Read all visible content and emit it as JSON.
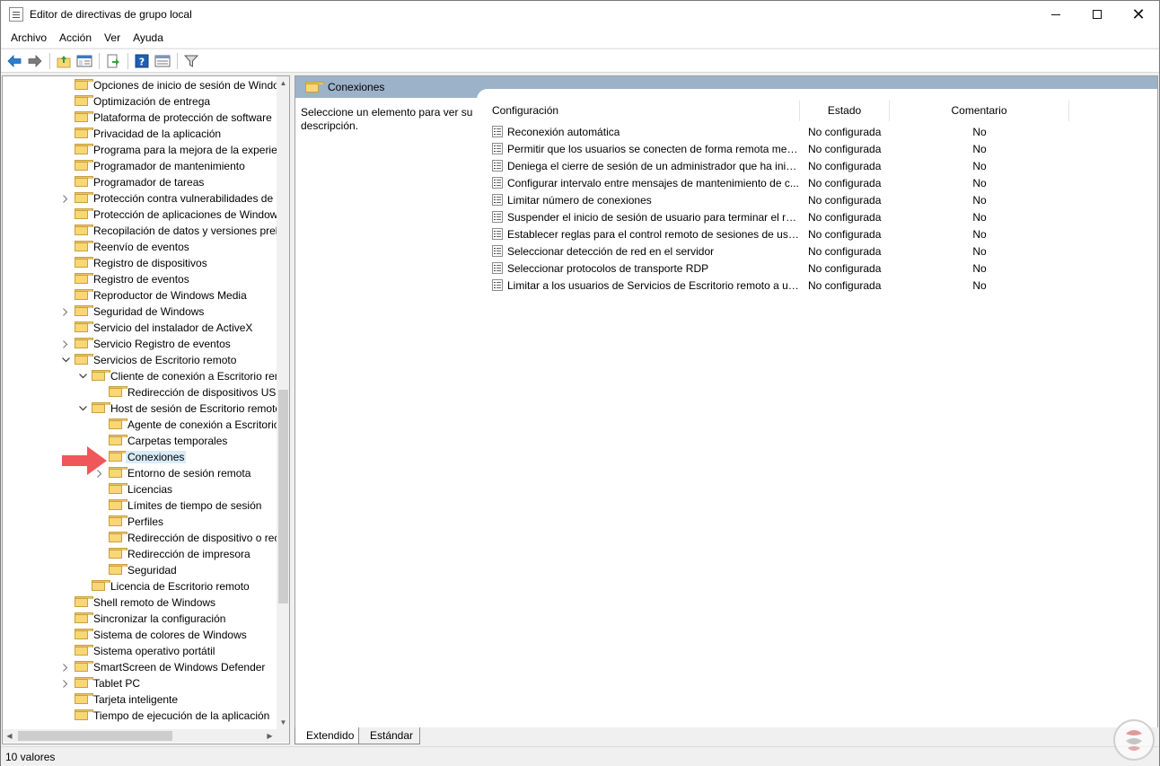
{
  "window": {
    "title": "Editor de directivas de grupo local",
    "controls": [
      "minimize",
      "maximize",
      "close"
    ]
  },
  "menu": [
    "Archivo",
    "Acción",
    "Ver",
    "Ayuda"
  ],
  "toolbar": {
    "buttons": [
      "back-icon",
      "forward-icon",
      "up-folder-icon",
      "show-hide-tree-icon",
      "export-list-icon",
      "help-icon",
      "properties-icon",
      "filter-icon"
    ]
  },
  "tree": {
    "items": [
      {
        "label": "Opciones de inicio de sesión de Windo",
        "level": 0,
        "expander": "none"
      },
      {
        "label": "Optimización de entrega",
        "level": 0,
        "expander": "none"
      },
      {
        "label": "Plataforma de protección de software",
        "level": 0,
        "expander": "none"
      },
      {
        "label": "Privacidad de la aplicación",
        "level": 0,
        "expander": "none"
      },
      {
        "label": "Programa para la mejora de la experien",
        "level": 0,
        "expander": "none"
      },
      {
        "label": "Programador de mantenimiento",
        "level": 0,
        "expander": "none"
      },
      {
        "label": "Programador de tareas",
        "level": 0,
        "expander": "none"
      },
      {
        "label": "Protección contra vulnerabilidades de",
        "level": 0,
        "expander": "collapsed"
      },
      {
        "label": "Protección de aplicaciones de Window",
        "level": 0,
        "expander": "none"
      },
      {
        "label": "Recopilación de datos y versiones preli",
        "level": 0,
        "expander": "none"
      },
      {
        "label": "Reenvío de eventos",
        "level": 0,
        "expander": "none"
      },
      {
        "label": "Registro de dispositivos",
        "level": 0,
        "expander": "none"
      },
      {
        "label": "Registro de eventos",
        "level": 0,
        "expander": "none"
      },
      {
        "label": "Reproductor de Windows Media",
        "level": 0,
        "expander": "none"
      },
      {
        "label": "Seguridad de Windows",
        "level": 0,
        "expander": "collapsed"
      },
      {
        "label": "Servicio del instalador de ActiveX",
        "level": 0,
        "expander": "none"
      },
      {
        "label": "Servicio Registro de eventos",
        "level": 0,
        "expander": "collapsed"
      },
      {
        "label": "Servicios de Escritorio remoto",
        "level": 0,
        "expander": "expanded"
      },
      {
        "label": "Cliente de conexión a Escritorio rem",
        "level": 1,
        "expander": "expanded"
      },
      {
        "label": "Redirección de dispositivos USB",
        "level": 2,
        "expander": "none"
      },
      {
        "label": "Host de sesión de Escritorio remoto",
        "level": 1,
        "expander": "expanded"
      },
      {
        "label": "Agente de conexión a Escritorio",
        "level": 2,
        "expander": "none"
      },
      {
        "label": "Carpetas temporales",
        "level": 2,
        "expander": "none"
      },
      {
        "label": "Conexiones",
        "level": 2,
        "expander": "none",
        "selected": true
      },
      {
        "label": "Entorno de sesión remota",
        "level": 2,
        "expander": "collapsed"
      },
      {
        "label": "Licencias",
        "level": 2,
        "expander": "none"
      },
      {
        "label": "Límites de tiempo de sesión",
        "level": 2,
        "expander": "none"
      },
      {
        "label": "Perfiles",
        "level": 2,
        "expander": "none"
      },
      {
        "label": "Redirección de dispositivo o rec",
        "level": 2,
        "expander": "none"
      },
      {
        "label": "Redirección de impresora",
        "level": 2,
        "expander": "none"
      },
      {
        "label": "Seguridad",
        "level": 2,
        "expander": "none"
      },
      {
        "label": "Licencia de Escritorio remoto",
        "level": 1,
        "expander": "none"
      },
      {
        "label": "Shell remoto de Windows",
        "level": 0,
        "expander": "none"
      },
      {
        "label": "Sincronizar la configuración",
        "level": 0,
        "expander": "none"
      },
      {
        "label": "Sistema de colores de Windows",
        "level": 0,
        "expander": "none"
      },
      {
        "label": "Sistema operativo portátil",
        "level": 0,
        "expander": "none"
      },
      {
        "label": "SmartScreen de Windows Defender",
        "level": 0,
        "expander": "collapsed"
      },
      {
        "label": "Tablet PC",
        "level": 0,
        "expander": "collapsed"
      },
      {
        "label": "Tarjeta inteligente",
        "level": 0,
        "expander": "none"
      },
      {
        "label": "Tiempo de ejecución de la aplicación",
        "level": 0,
        "expander": "none"
      }
    ]
  },
  "details": {
    "header_title": "Conexiones",
    "description": "Seleccione un elemento para ver su descripción.",
    "columns": {
      "config": "Configuración",
      "estado": "Estado",
      "comentario": "Comentario"
    },
    "rows": [
      {
        "config": "Reconexión automática",
        "estado": "No configurada",
        "comentario": "No"
      },
      {
        "config": "Permitir que los usuarios se conecten de forma remota med...",
        "estado": "No configurada",
        "comentario": "No"
      },
      {
        "config": "Deniega el cierre de sesión de un administrador que ha inici...",
        "estado": "No configurada",
        "comentario": "No"
      },
      {
        "config": "Configurar intervalo entre mensajes de mantenimiento de c...",
        "estado": "No configurada",
        "comentario": "No"
      },
      {
        "config": "Limitar número de conexiones",
        "estado": "No configurada",
        "comentario": "No"
      },
      {
        "config": "Suspender el inicio de sesión de usuario para terminar el reg...",
        "estado": "No configurada",
        "comentario": "No"
      },
      {
        "config": "Establecer reglas para el control remoto de sesiones de usua...",
        "estado": "No configurada",
        "comentario": "No"
      },
      {
        "config": "Seleccionar detección de red en el servidor",
        "estado": "No configurada",
        "comentario": "No"
      },
      {
        "config": "Seleccionar protocolos de transporte RDP",
        "estado": "No configurada",
        "comentario": "No"
      },
      {
        "config": "Limitar a los usuarios de Servicios de Escritorio remoto a un...",
        "estado": "No configurada",
        "comentario": "No"
      }
    ]
  },
  "tabs": {
    "extended": "Extendido",
    "standard": "Estándar"
  },
  "status": "10 valores",
  "colors": {
    "header_bar": "#9cb2c8",
    "selection": "#d9ebf9",
    "annotation_arrow": "#f0575a",
    "folder": "#f8d775"
  }
}
